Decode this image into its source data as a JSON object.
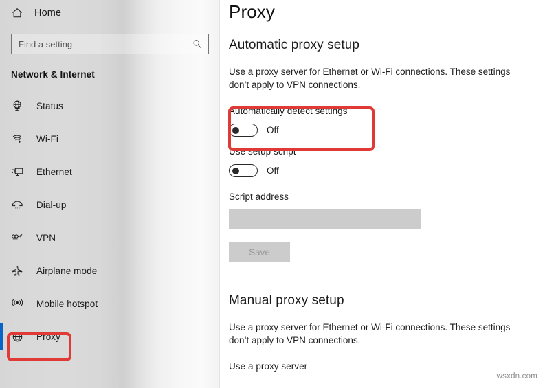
{
  "sidebar": {
    "home_label": "Home",
    "home_icon": "home-icon",
    "search": {
      "placeholder": "Find a setting",
      "value": "",
      "icon": "search-icon"
    },
    "category_title": "Network & Internet",
    "items": [
      {
        "label": "Status",
        "icon": "globe-status-icon",
        "selected": false
      },
      {
        "label": "Wi-Fi",
        "icon": "wifi-icon",
        "selected": false
      },
      {
        "label": "Ethernet",
        "icon": "ethernet-icon",
        "selected": false
      },
      {
        "label": "Dial-up",
        "icon": "dialup-phone-icon",
        "selected": false
      },
      {
        "label": "VPN",
        "icon": "vpn-key-icon",
        "selected": false
      },
      {
        "label": "Airplane mode",
        "icon": "airplane-icon",
        "selected": false
      },
      {
        "label": "Mobile hotspot",
        "icon": "mobile-hotspot-icon",
        "selected": false
      },
      {
        "label": "Proxy",
        "icon": "globe-proxy-icon",
        "selected": true
      }
    ]
  },
  "content": {
    "page_title": "Proxy",
    "automatic": {
      "heading": "Automatic proxy setup",
      "description": "Use a proxy server for Ethernet or Wi-Fi connections. These settings don’t apply to VPN connections.",
      "auto_detect_label": "Automatically detect settings",
      "auto_detect_state": "Off",
      "setup_script_label": "Use setup script",
      "setup_script_state": "Off",
      "script_address_label": "Script address",
      "script_address_value": "",
      "save_label": "Save"
    },
    "manual": {
      "heading": "Manual proxy setup",
      "description": "Use a proxy server for Ethernet or Wi-Fi connections. These settings don’t apply to VPN connections.",
      "use_proxy_label": "Use a proxy server"
    }
  },
  "annotations": {
    "color": "#e03a36",
    "targets": [
      "sidebar-item-proxy",
      "automatically-detect-settings-group"
    ]
  },
  "selection_accent": "#0a64c8",
  "watermark": "wsxdn.com"
}
